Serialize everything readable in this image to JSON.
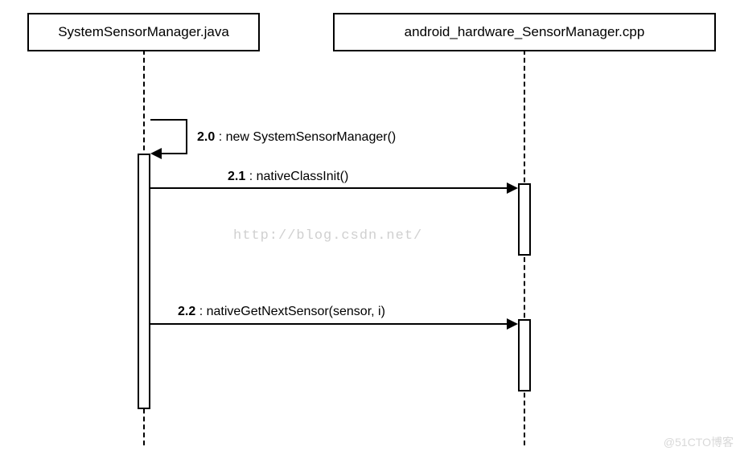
{
  "participants": {
    "left": "SystemSensorManager.java",
    "right": "android_hardware_SensorManager.cpp"
  },
  "messages": {
    "m0": {
      "num": "2.0",
      "text": "new SystemSensorManager()"
    },
    "m1": {
      "num": "2.1",
      "text": "nativeClassInit()"
    },
    "m2": {
      "num": "2.2",
      "text": "nativeGetNextSensor(sensor, i)"
    }
  },
  "watermarks": {
    "center": "http://blog.csdn.net/",
    "corner": "@51CTO博客"
  }
}
